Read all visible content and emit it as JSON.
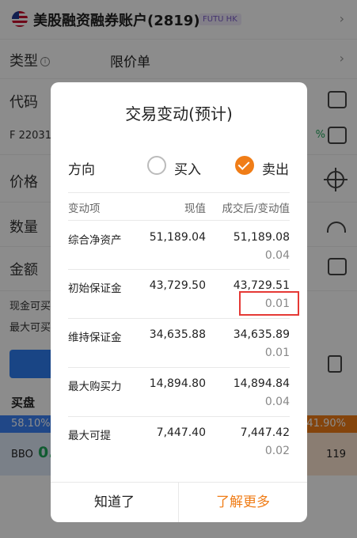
{
  "header": {
    "account_title": "美股融资融券账户(2819)",
    "badge": "FUTU HK"
  },
  "form": {
    "type_label": "类型",
    "type_value": "限价单",
    "code_label": "代码",
    "code_sub": "F 22031",
    "code_pct": "%",
    "price_label": "价格",
    "qty_label": "数量",
    "amount_label": "金额",
    "cash_buy_label": "现金可买",
    "max_buy_label": "最大可买"
  },
  "orderbook": {
    "title": "买盘",
    "bid_pct": "58.10%",
    "ask_pct": "41.90%",
    "bbo_label": "BBO",
    "bbo_value": "0.",
    "ask_qty": "119"
  },
  "dialog": {
    "title": "交易变动(预计)",
    "direction_label": "方向",
    "buy_label": "买入",
    "sell_label": "卖出",
    "selected": "sell",
    "columns": [
      "变动项",
      "现值",
      "成交后/变动值"
    ],
    "rows": [
      {
        "name": "综合净资产",
        "current": "51,189.04",
        "after": "51,189.08",
        "diff": "0.04"
      },
      {
        "name": "初始保证金",
        "current": "43,729.50",
        "after": "43,729.51",
        "diff": "0.01"
      },
      {
        "name": "维持保证金",
        "current": "34,635.88",
        "after": "34,635.89",
        "diff": "0.01"
      },
      {
        "name": "最大购买力",
        "current": "14,894.80",
        "after": "14,894.84",
        "diff": "0.04"
      },
      {
        "name": "最大可提",
        "current": "7,447.40",
        "after": "7,447.42",
        "diff": "0.02"
      }
    ],
    "ok_label": "知道了",
    "more_label": "了解更多"
  },
  "colors": {
    "accent": "#f07d17",
    "bid": "#3b82f6",
    "highlight": "#e53935"
  },
  "icons": [
    "flag-icon",
    "chevron-right-icon",
    "info-icon",
    "tray-icon",
    "chart-icon",
    "crosshair-icon",
    "gauge-icon",
    "calculator-icon",
    "clipboard-icon",
    "checkmark-icon"
  ]
}
